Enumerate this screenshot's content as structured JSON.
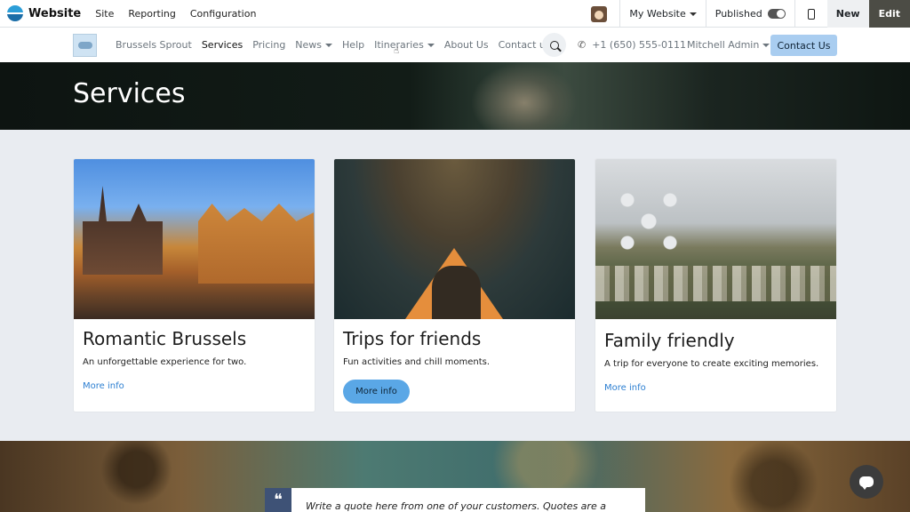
{
  "admin_bar": {
    "app_name": "Website",
    "menu": [
      "Site",
      "Reporting",
      "Configuration"
    ],
    "website_selector": "My Website",
    "published_label": "Published",
    "new_label": "New",
    "edit_label": "Edit"
  },
  "site_nav": {
    "links": [
      "Brussels Sprout",
      "Services",
      "Pricing",
      "News",
      "Help",
      "Itineraries",
      "About Us",
      "Contact us"
    ],
    "active": "Services",
    "phone": "+1 (650) 555-0111",
    "user": "Mitchell Admin",
    "cta": "Contact Us"
  },
  "hero": {
    "title": "Services"
  },
  "cards": [
    {
      "title": "Romantic Brussels",
      "text": "An unforgettable experience for two.",
      "link": "More info"
    },
    {
      "title": "Trips for friends",
      "text": "Fun activities and chill moments.",
      "link": "More info"
    },
    {
      "title": "Family friendly",
      "text": "A trip for everyone to create exciting memories.",
      "link": "More info"
    }
  ],
  "quote": {
    "text": "Write a quote here from one of your customers. Quotes are a"
  },
  "colors": {
    "accent": "#a9cdf0",
    "button_blue": "#5aa7e6",
    "link_blue": "#2b7ed1",
    "edit_bg": "#4c4c45"
  }
}
